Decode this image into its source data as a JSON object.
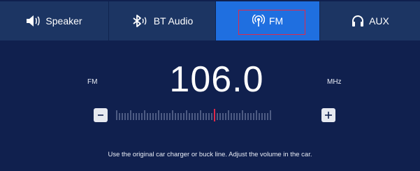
{
  "tabs": [
    {
      "label": "Speaker",
      "icon": "speaker-icon"
    },
    {
      "label": "BT Audio",
      "icon": "bluetooth-icon"
    },
    {
      "label": "FM",
      "icon": "radio-icon",
      "selected": true
    },
    {
      "label": "AUX",
      "icon": "headphones-icon"
    }
  ],
  "radio": {
    "band": "FM",
    "frequency": "106.0",
    "unit": "MHz"
  },
  "tuner": {
    "minus_label": "−",
    "plus_label": "+"
  },
  "hint": "Use the original car charger or buck line. Adjust the volume in the car.",
  "colors": {
    "background": "#10204e",
    "tabbar": "#1c3563",
    "active_tab": "#1f6fe0",
    "highlight": "#e0294a",
    "marker": "#e0294a"
  }
}
